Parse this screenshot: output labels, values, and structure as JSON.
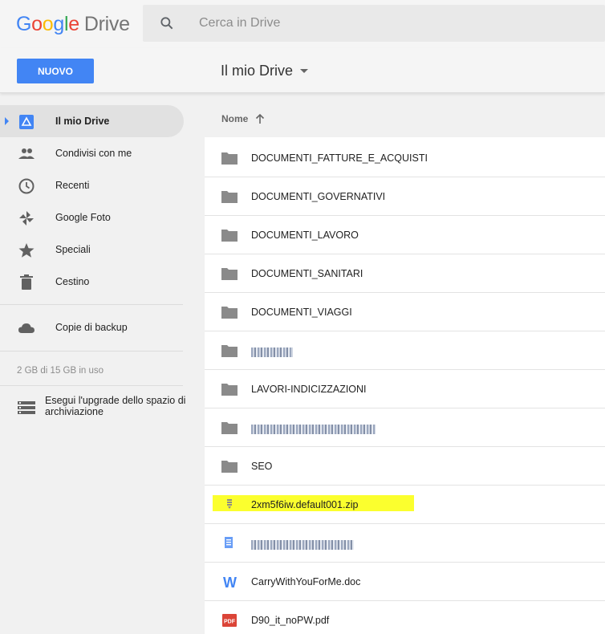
{
  "header": {
    "logo_letters": [
      "G",
      "o",
      "o",
      "g",
      "l",
      "e"
    ],
    "logo_product": "Drive",
    "search_placeholder": "Cerca in Drive",
    "search_value": ""
  },
  "toolbar": {
    "new_label": "NUOVO",
    "location_title": "Il mio Drive"
  },
  "sidebar": {
    "items": [
      {
        "label": "Il mio Drive",
        "icon": "drive-icon",
        "active": true
      },
      {
        "label": "Condivisi con me",
        "icon": "people-icon"
      },
      {
        "label": "Recenti",
        "icon": "clock-icon"
      },
      {
        "label": "Google Foto",
        "icon": "pinwheel-icon"
      },
      {
        "label": "Speciali",
        "icon": "star-icon"
      },
      {
        "label": "Cestino",
        "icon": "trash-icon"
      },
      {
        "label": "Copie di backup",
        "icon": "cloud-icon"
      }
    ],
    "storage": "2 GB di 15 GB in uso",
    "upgrade_label": "Esegui l'upgrade dello spazio di archiviazione"
  },
  "list": {
    "column_name": "Nome",
    "rows": [
      {
        "name": "DOCUMENTI_FATTURE_E_ACQUISTI",
        "type": "folder"
      },
      {
        "name": "DOCUMENTI_GOVERNATIVI",
        "type": "folder"
      },
      {
        "name": "DOCUMENTI_LAVORO",
        "type": "folder"
      },
      {
        "name": "DOCUMENTI_SANITARI",
        "type": "folder"
      },
      {
        "name": "DOCUMENTI_VIAGGI",
        "type": "folder"
      },
      {
        "name": "",
        "type": "folder",
        "obscured": true
      },
      {
        "name": "LAVORI-INDICIZZAZIONI",
        "type": "folder"
      },
      {
        "name": "",
        "type": "folder",
        "obscured": true
      },
      {
        "name": "SEO",
        "type": "folder"
      },
      {
        "name": "2xm5f6iw.default001.zip",
        "type": "zip",
        "highlighted": true
      },
      {
        "name": "",
        "type": "txt",
        "obscured": true
      },
      {
        "name": "CarryWithYouForMe.doc",
        "type": "doc"
      },
      {
        "name": "D90_it_noPW.pdf",
        "type": "pdf"
      }
    ]
  },
  "colors": {
    "accent": "#4285f4",
    "highlight": "#fbff2e",
    "pdf": "#db4437",
    "folder": "#8a8a8a"
  }
}
